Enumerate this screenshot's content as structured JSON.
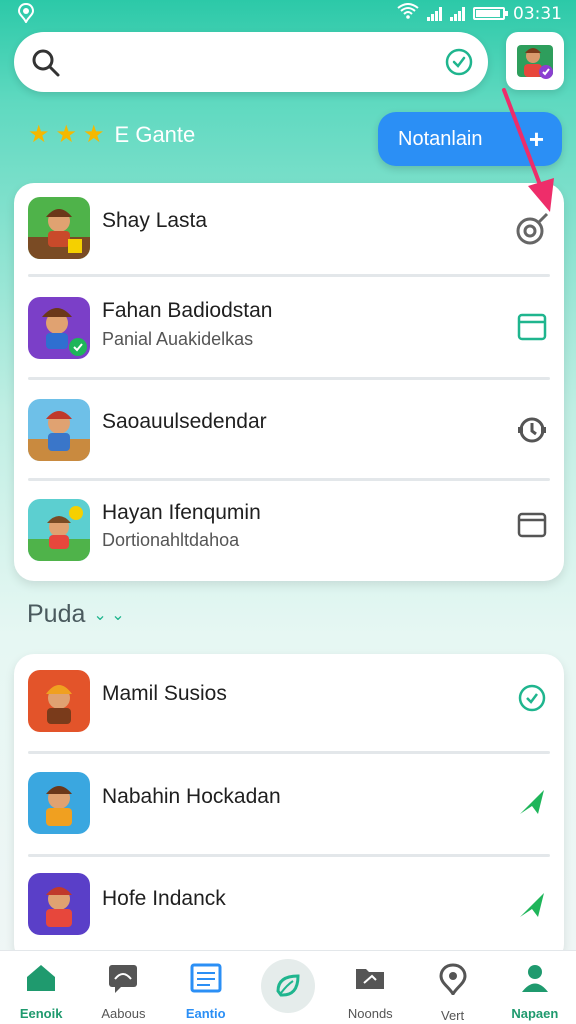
{
  "status_bar": {
    "time": "03:31"
  },
  "search": {
    "placeholder": ""
  },
  "header": {
    "rating_label": "E Gante",
    "stars": 3,
    "primary_button": "Notanlain"
  },
  "apps_main": [
    {
      "title": "Shay Lasta",
      "subtitle": "",
      "action_icon": "settings-ring-icon"
    },
    {
      "title": "Fahan Badiodstan",
      "subtitle": "Panial Auakidelkas",
      "action_icon": "window-icon"
    },
    {
      "title": "Saoauulsedendar",
      "subtitle": "",
      "action_icon": "refresh-icon"
    },
    {
      "title": "Hayan Ifenqumin",
      "subtitle": "Dortionahltdahoa",
      "action_icon": "window-dark-icon"
    }
  ],
  "section": {
    "title": "Puda"
  },
  "apps_secondary": [
    {
      "title": "Mamil Susios",
      "action_icon": "clock-icon"
    },
    {
      "title": "Nabahin Hockadan",
      "action_icon": "send-icon"
    },
    {
      "title": "Hofe Indanck",
      "action_icon": "send-icon"
    }
  ],
  "bottom_nav": [
    {
      "label": "Eenoik",
      "icon": "home-icon"
    },
    {
      "label": "Aabous",
      "icon": "chat-icon"
    },
    {
      "label": "Eantio",
      "icon": "list-icon"
    },
    {
      "label": "",
      "icon": "leaf-icon"
    },
    {
      "label": "Noonds",
      "icon": "folder-icon"
    },
    {
      "label": "Vert",
      "icon": "location-icon"
    },
    {
      "label": "Napaen",
      "icon": "profile-icon"
    }
  ],
  "colors": {
    "accent": "#1fb58e",
    "primary": "#2b8ff5",
    "star": "#f5b800",
    "pointer": "#ee2d6a"
  }
}
